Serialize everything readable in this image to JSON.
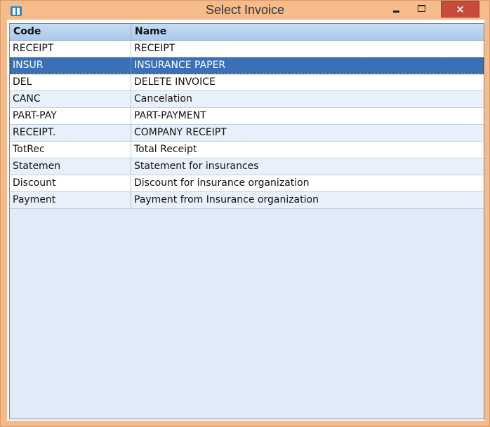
{
  "window": {
    "title": "Select Invoice",
    "close_glyph": "×",
    "icons": {
      "app": "app-icon",
      "minimize": "minimize-icon",
      "maximize": "maximize-icon",
      "close": "close-icon"
    }
  },
  "table": {
    "columns": [
      "Code",
      "Name"
    ],
    "selected_index": 1,
    "rows": [
      {
        "code": "RECEIPT",
        "name": "RECEIPT"
      },
      {
        "code": "INSUR",
        "name": "INSURANCE PAPER"
      },
      {
        "code": "DEL",
        "name": "DELETE INVOICE"
      },
      {
        "code": "CANC",
        "name": "Cancelation"
      },
      {
        "code": "PART-PAY",
        "name": "PART-PAYMENT"
      },
      {
        "code": "RECEIPT.",
        "name": "COMPANY RECEIPT"
      },
      {
        "code": "TotRec",
        "name": "Total Receipt"
      },
      {
        "code": "Statemen",
        "name": "Statement for insurances"
      },
      {
        "code": "Discount",
        "name": "Discount for insurance organization"
      },
      {
        "code": "Payment",
        "name": "Payment from Insurance organization"
      }
    ]
  },
  "colors": {
    "titlebar": "#f6bb8a",
    "close_button": "#c84a3c",
    "selected_row": "#3b70b6",
    "table_background": "#e2ecf9"
  }
}
